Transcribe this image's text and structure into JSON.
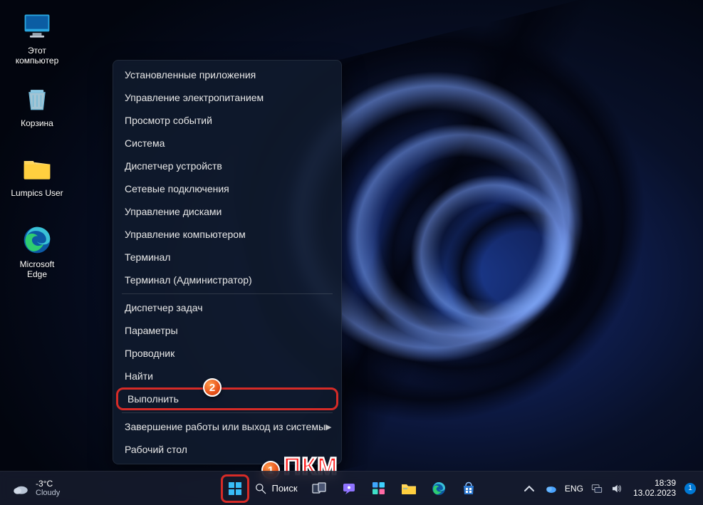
{
  "desktop": {
    "icons": [
      {
        "name": "this-pc",
        "label": "Этот\nкомпьютер"
      },
      {
        "name": "recycle-bin",
        "label": "Корзина"
      },
      {
        "name": "user-folder",
        "label": "Lumpics User"
      },
      {
        "name": "edge",
        "label": "Microsoft\nEdge"
      }
    ]
  },
  "context_menu": {
    "groups": [
      [
        "Установленные приложения",
        "Управление электропитанием",
        "Просмотр событий",
        "Система",
        "Диспетчер устройств",
        "Сетевые подключения",
        "Управление дисками",
        "Управление компьютером",
        "Терминал",
        "Терминал (Администратор)"
      ],
      [
        "Диспетчер задач",
        "Параметры",
        "Проводник",
        "Найти",
        "Выполнить"
      ],
      [
        {
          "label": "Завершение работы или выход из системы",
          "submenu": true
        },
        "Рабочий стол"
      ]
    ],
    "highlighted_item": "Выполнить"
  },
  "annotations": {
    "badge1": "1",
    "badge2": "2",
    "pkm": "ПКМ"
  },
  "taskbar": {
    "weather": {
      "temp": "-3°C",
      "condition": "Cloudy"
    },
    "search_label": "Поиск",
    "lang": "ENG",
    "time": "18:39",
    "date": "13.02.2023",
    "notification_count": "1",
    "apps": [
      "start",
      "search",
      "task-view",
      "chat",
      "widgets",
      "file-explorer",
      "edge",
      "store"
    ]
  }
}
